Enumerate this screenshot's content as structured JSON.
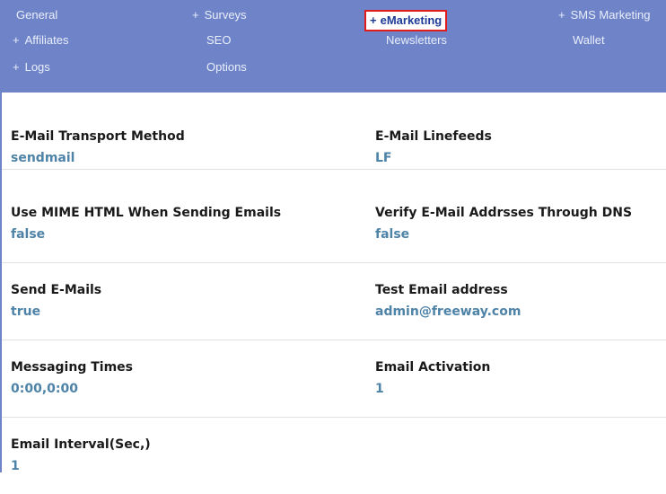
{
  "nav": {
    "row1": [
      {
        "label": "General",
        "plus": ""
      },
      {
        "label": "Surveys",
        "plus": "+"
      },
      {
        "label": "eMarketing",
        "plus": "+"
      },
      {
        "label": "SMS Marketing",
        "plus": "+"
      }
    ],
    "row2": [
      {
        "label": "Affiliates",
        "plus": "+"
      },
      {
        "label": "SEO",
        "plus": ""
      },
      {
        "label": "Newsletters",
        "plus": ""
      },
      {
        "label": "Wallet",
        "plus": ""
      }
    ],
    "row3": [
      {
        "label": "Logs",
        "plus": "+"
      },
      {
        "label": "Options",
        "plus": ""
      }
    ],
    "active": "eMarketing",
    "colors": {
      "bar": "#6f84c8",
      "active_border": "#e21b1b"
    }
  },
  "settings": [
    {
      "left": {
        "label": "E-Mail Transport Method",
        "value": "sendmail"
      },
      "right": {
        "label": "E-Mail Linefeeds",
        "value": "LF"
      }
    },
    {
      "left": {
        "label": "Use MIME HTML When Sending Emails",
        "value": "false"
      },
      "right": {
        "label": "Verify E-Mail Addrsses Through DNS",
        "value": "false"
      }
    },
    {
      "left": {
        "label": "Send E-Mails",
        "value": "true"
      },
      "right": {
        "label": "Test Email address",
        "value": "admin@freeway.com"
      }
    },
    {
      "left": {
        "label": "Messaging Times",
        "value": "0:00,0:00"
      },
      "right": {
        "label": "Email Activation",
        "value": "1"
      }
    },
    {
      "left": {
        "label": "Email Interval(Sec,)",
        "value": "1"
      }
    }
  ],
  "colors": {
    "value_text": "#4e83a8",
    "label_text": "#1a1a1a"
  }
}
